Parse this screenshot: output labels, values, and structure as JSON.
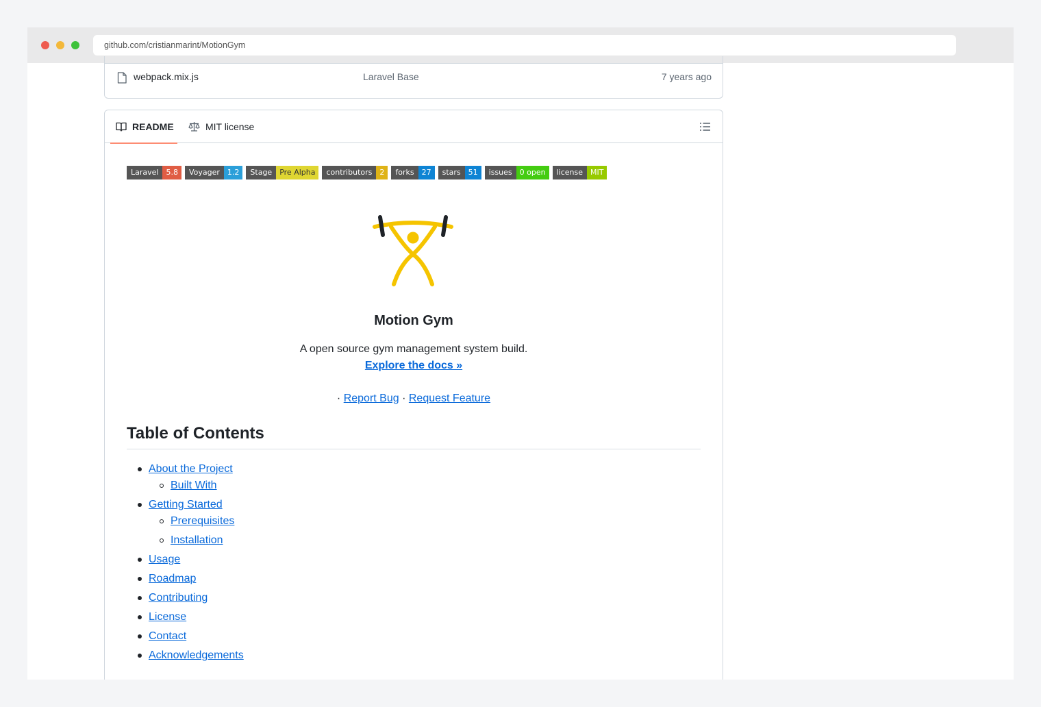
{
  "browser": {
    "url": "github.com/cristianmarint/MotionGym"
  },
  "file_row": {
    "name": "webpack.mix.js",
    "commit_message": "Laravel Base",
    "age": "7 years ago"
  },
  "tabs": [
    {
      "label": "README",
      "icon": "book-icon",
      "active": true
    },
    {
      "label": "MIT license",
      "icon": "scale-icon",
      "active": false
    }
  ],
  "badges": [
    {
      "label": "Laravel",
      "value": "5.8",
      "color": "#e05d44"
    },
    {
      "label": "Voyager",
      "value": "1.2",
      "color": "#2b9fd9"
    },
    {
      "label": "Stage",
      "value": "Pre Alpha",
      "color": "#dfd632",
      "dark_text": true
    },
    {
      "label": "contributors",
      "value": "2",
      "color": "#dfb317"
    },
    {
      "label": "forks",
      "value": "27",
      "color": "#0e84d4"
    },
    {
      "label": "stars",
      "value": "51",
      "color": "#0e84d4"
    },
    {
      "label": "issues",
      "value": "0 open",
      "color": "#4c1"
    },
    {
      "label": "license",
      "value": "MIT",
      "color": "#97ca00"
    }
  ],
  "project": {
    "title": "Motion Gym",
    "description": "A open source gym management system build.",
    "docs_link": "Explore the docs »",
    "separator": "·",
    "report_bug": "Report Bug",
    "request_feature": "Request Feature",
    "logo_color": "#f5c400"
  },
  "toc": {
    "heading": "Table of Contents",
    "items": [
      {
        "label": "About the Project",
        "level": 1
      },
      {
        "label": "Built With",
        "level": 2
      },
      {
        "label": "Getting Started",
        "level": 1
      },
      {
        "label": "Prerequisites",
        "level": 2
      },
      {
        "label": "Installation",
        "level": 2
      },
      {
        "label": "Usage",
        "level": 1
      },
      {
        "label": "Roadmap",
        "level": 1
      },
      {
        "label": "Contributing",
        "level": 1
      },
      {
        "label": "License",
        "level": 1
      },
      {
        "label": "Contact",
        "level": 1
      },
      {
        "label": "Acknowledgements",
        "level": 1
      }
    ]
  }
}
